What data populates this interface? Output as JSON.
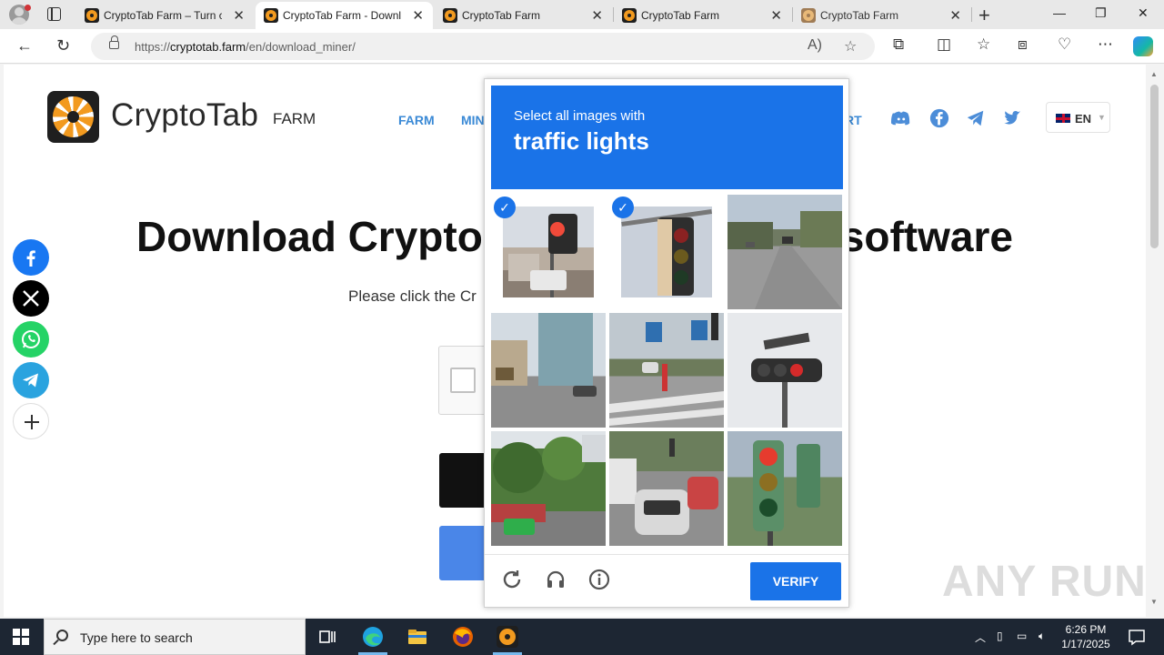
{
  "browser": {
    "tabs": [
      {
        "title": "CryptoTab Farm – Turn c",
        "active": false
      },
      {
        "title": "CryptoTab Farm - Downl",
        "active": true
      },
      {
        "title": "CryptoTab Farm",
        "active": false
      },
      {
        "title": "CryptoTab Farm",
        "active": false
      },
      {
        "title": "CryptoTab Farm",
        "active": false
      }
    ],
    "url_prefix": "https://",
    "url_host": "cryptotab.farm",
    "url_path": "/en/download_miner/"
  },
  "site": {
    "logo_text": "CryptoTab",
    "logo_suffix": "FARM",
    "nav": [
      "FARM",
      "MIN",
      "RT"
    ],
    "language": "EN",
    "headline_left": "Download Crypto",
    "headline_right": "software",
    "subtext": "Please click the Cr"
  },
  "captcha": {
    "prompt_line1": "Select all images with",
    "prompt_line2": "traffic lights",
    "selected_tiles": [
      0,
      1
    ],
    "verify_label": "VERIFY"
  },
  "watermark": "ANY RUN",
  "taskbar": {
    "search_placeholder": "Type here to search",
    "time": "6:26 PM",
    "date": "1/17/2025"
  },
  "colors": {
    "accent": "#1a73e8",
    "nav_link": "#3b8ad6",
    "taskbar": "#1d2633"
  }
}
